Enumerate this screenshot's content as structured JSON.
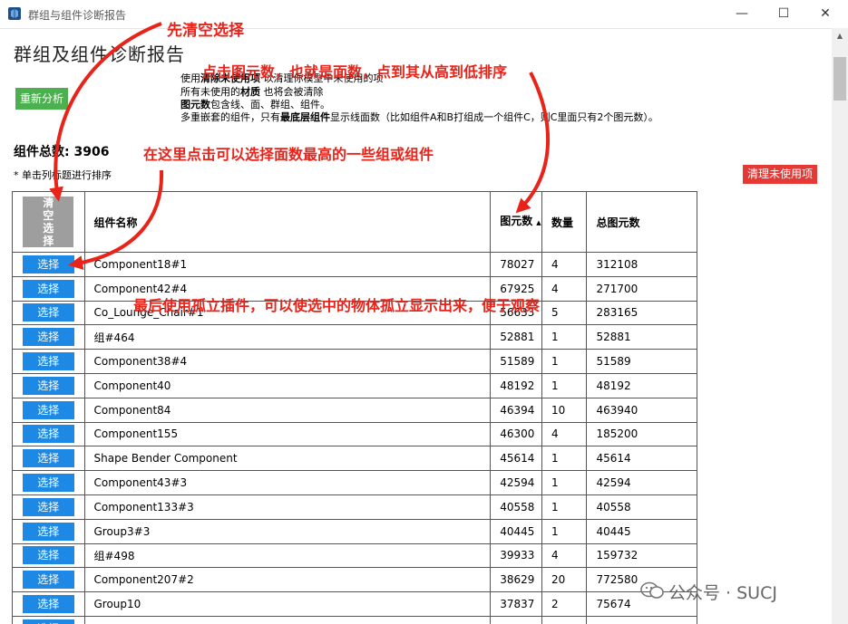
{
  "window": {
    "title": "群组与组件诊断报告",
    "min_glyph": "—",
    "max_glyph": "☐",
    "close_glyph": "✕"
  },
  "page_title": "群组及组件诊断报告",
  "reanalyze_label": "重新分析",
  "info": {
    "line1_a": "使用",
    "line1_b": "清除未使用项",
    "line1_c": "以清理你模型中未使用的项",
    "line2_a": "所有未使用的",
    "line2_b": "材质",
    "line2_c": "也将会被清除",
    "line3_a": "图元数",
    "line3_b": "包含线、面、群组、组件。",
    "line4_a": "多重嵌套的组件，只有",
    "line4_b": "最底层组件",
    "line4_c": "显示线面数（比如组件A和B打组成一个组件C，则C里面只有2个图元数）。"
  },
  "total_label": "组件总数: 3906",
  "sort_hint": "* 单击列标题进行排序",
  "cleanup_label": "清理未使用项",
  "table": {
    "headers": {
      "clear": "清空选择",
      "name": "组件名称",
      "elements": "图元数",
      "sort_arrow": "▲",
      "count": "数量",
      "total": "总图元数"
    },
    "select_label": "选择",
    "rows": [
      {
        "name": "Component18#1",
        "elements": "78027",
        "count": "4",
        "total": "312108"
      },
      {
        "name": "Component42#4",
        "elements": "67925",
        "count": "4",
        "total": "271700"
      },
      {
        "name": "Co_Lounge_Chair#1",
        "elements": "56633",
        "count": "5",
        "total": "283165"
      },
      {
        "name": "组#464",
        "elements": "52881",
        "count": "1",
        "total": "52881"
      },
      {
        "name": "Component38#4",
        "elements": "51589",
        "count": "1",
        "total": "51589"
      },
      {
        "name": "Component40",
        "elements": "48192",
        "count": "1",
        "total": "48192"
      },
      {
        "name": "Component84",
        "elements": "46394",
        "count": "10",
        "total": "463940"
      },
      {
        "name": "Component155",
        "elements": "46300",
        "count": "4",
        "total": "185200"
      },
      {
        "name": "Shape Bender Component",
        "elements": "45614",
        "count": "1",
        "total": "45614"
      },
      {
        "name": "Component43#3",
        "elements": "42594",
        "count": "1",
        "total": "42594"
      },
      {
        "name": "Component133#3",
        "elements": "40558",
        "count": "1",
        "total": "40558"
      },
      {
        "name": "Group3#3",
        "elements": "40445",
        "count": "1",
        "total": "40445"
      },
      {
        "name": "组#498",
        "elements": "39933",
        "count": "4",
        "total": "159732"
      },
      {
        "name": "Component207#2",
        "elements": "38629",
        "count": "20",
        "total": "772580"
      },
      {
        "name": "Group10",
        "elements": "37837",
        "count": "2",
        "total": "75674"
      },
      {
        "name": "",
        "elements": "",
        "count": "",
        "total": ""
      }
    ]
  },
  "annotations": {
    "a1": "先清空选择",
    "a2": "点击图元数，也就是面数，点到其从高到低排序",
    "a3": "在这里点击可以选择面数最高的一些组或组件",
    "a4": "最后使用孤立插件，可以使选中的物体孤立显示出来，便于观察",
    "color": "#e8231a"
  },
  "watermark": "公众号 · SUCJ",
  "colors": {
    "reanalyze": "#4caf50",
    "cleanup": "#e53935",
    "select": "#1e88e5",
    "clear": "#9e9e9e"
  }
}
